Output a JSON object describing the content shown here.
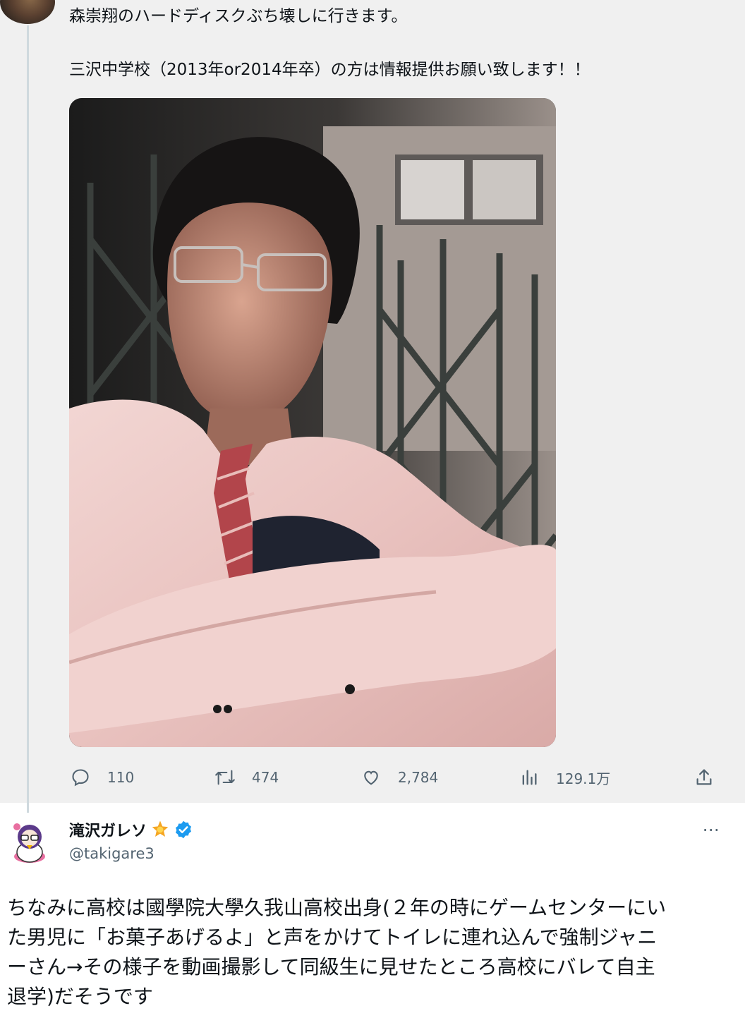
{
  "parent_tweet": {
    "text_lines": [
      "森崇翔のハードディスクぶち壊しに行きます。",
      "三沢中学校（2013年or2014年卒）の方は情報提供お願い致します！！"
    ],
    "media": {
      "type": "photo"
    },
    "actions": {
      "reply": {
        "icon": "reply-icon",
        "count": "110"
      },
      "retweet": {
        "icon": "retweet-icon",
        "count": "474"
      },
      "like": {
        "icon": "heart-icon",
        "count": "2,784"
      },
      "views": {
        "icon": "analytics-icon",
        "count": "129.1万"
      },
      "share": {
        "icon": "share-icon"
      }
    }
  },
  "reply_tweet": {
    "author": {
      "display_name": "滝沢ガレソ",
      "name_emoji": "star-emoji-icon",
      "verified": true,
      "handle": "@takigare3"
    },
    "more_label": "⋯",
    "body_lines": [
      "ちなみに高校は國學院大學久我山高校出身(２年の時にゲームセンターにい",
      "た男児に「お菓子あげるよ」と声をかけてトイレに連れ込んで強制ジャニ",
      "ーさん→その様子を動画撮影して同級生に見せたところ高校にバレて自主",
      "退学)だそうです"
    ]
  },
  "colors": {
    "text_primary": "#0f1419",
    "text_secondary": "#536471",
    "verified_blue": "#1d9bf0",
    "parent_background": "#f0f0f0",
    "thread_line": "#cfd9de"
  }
}
